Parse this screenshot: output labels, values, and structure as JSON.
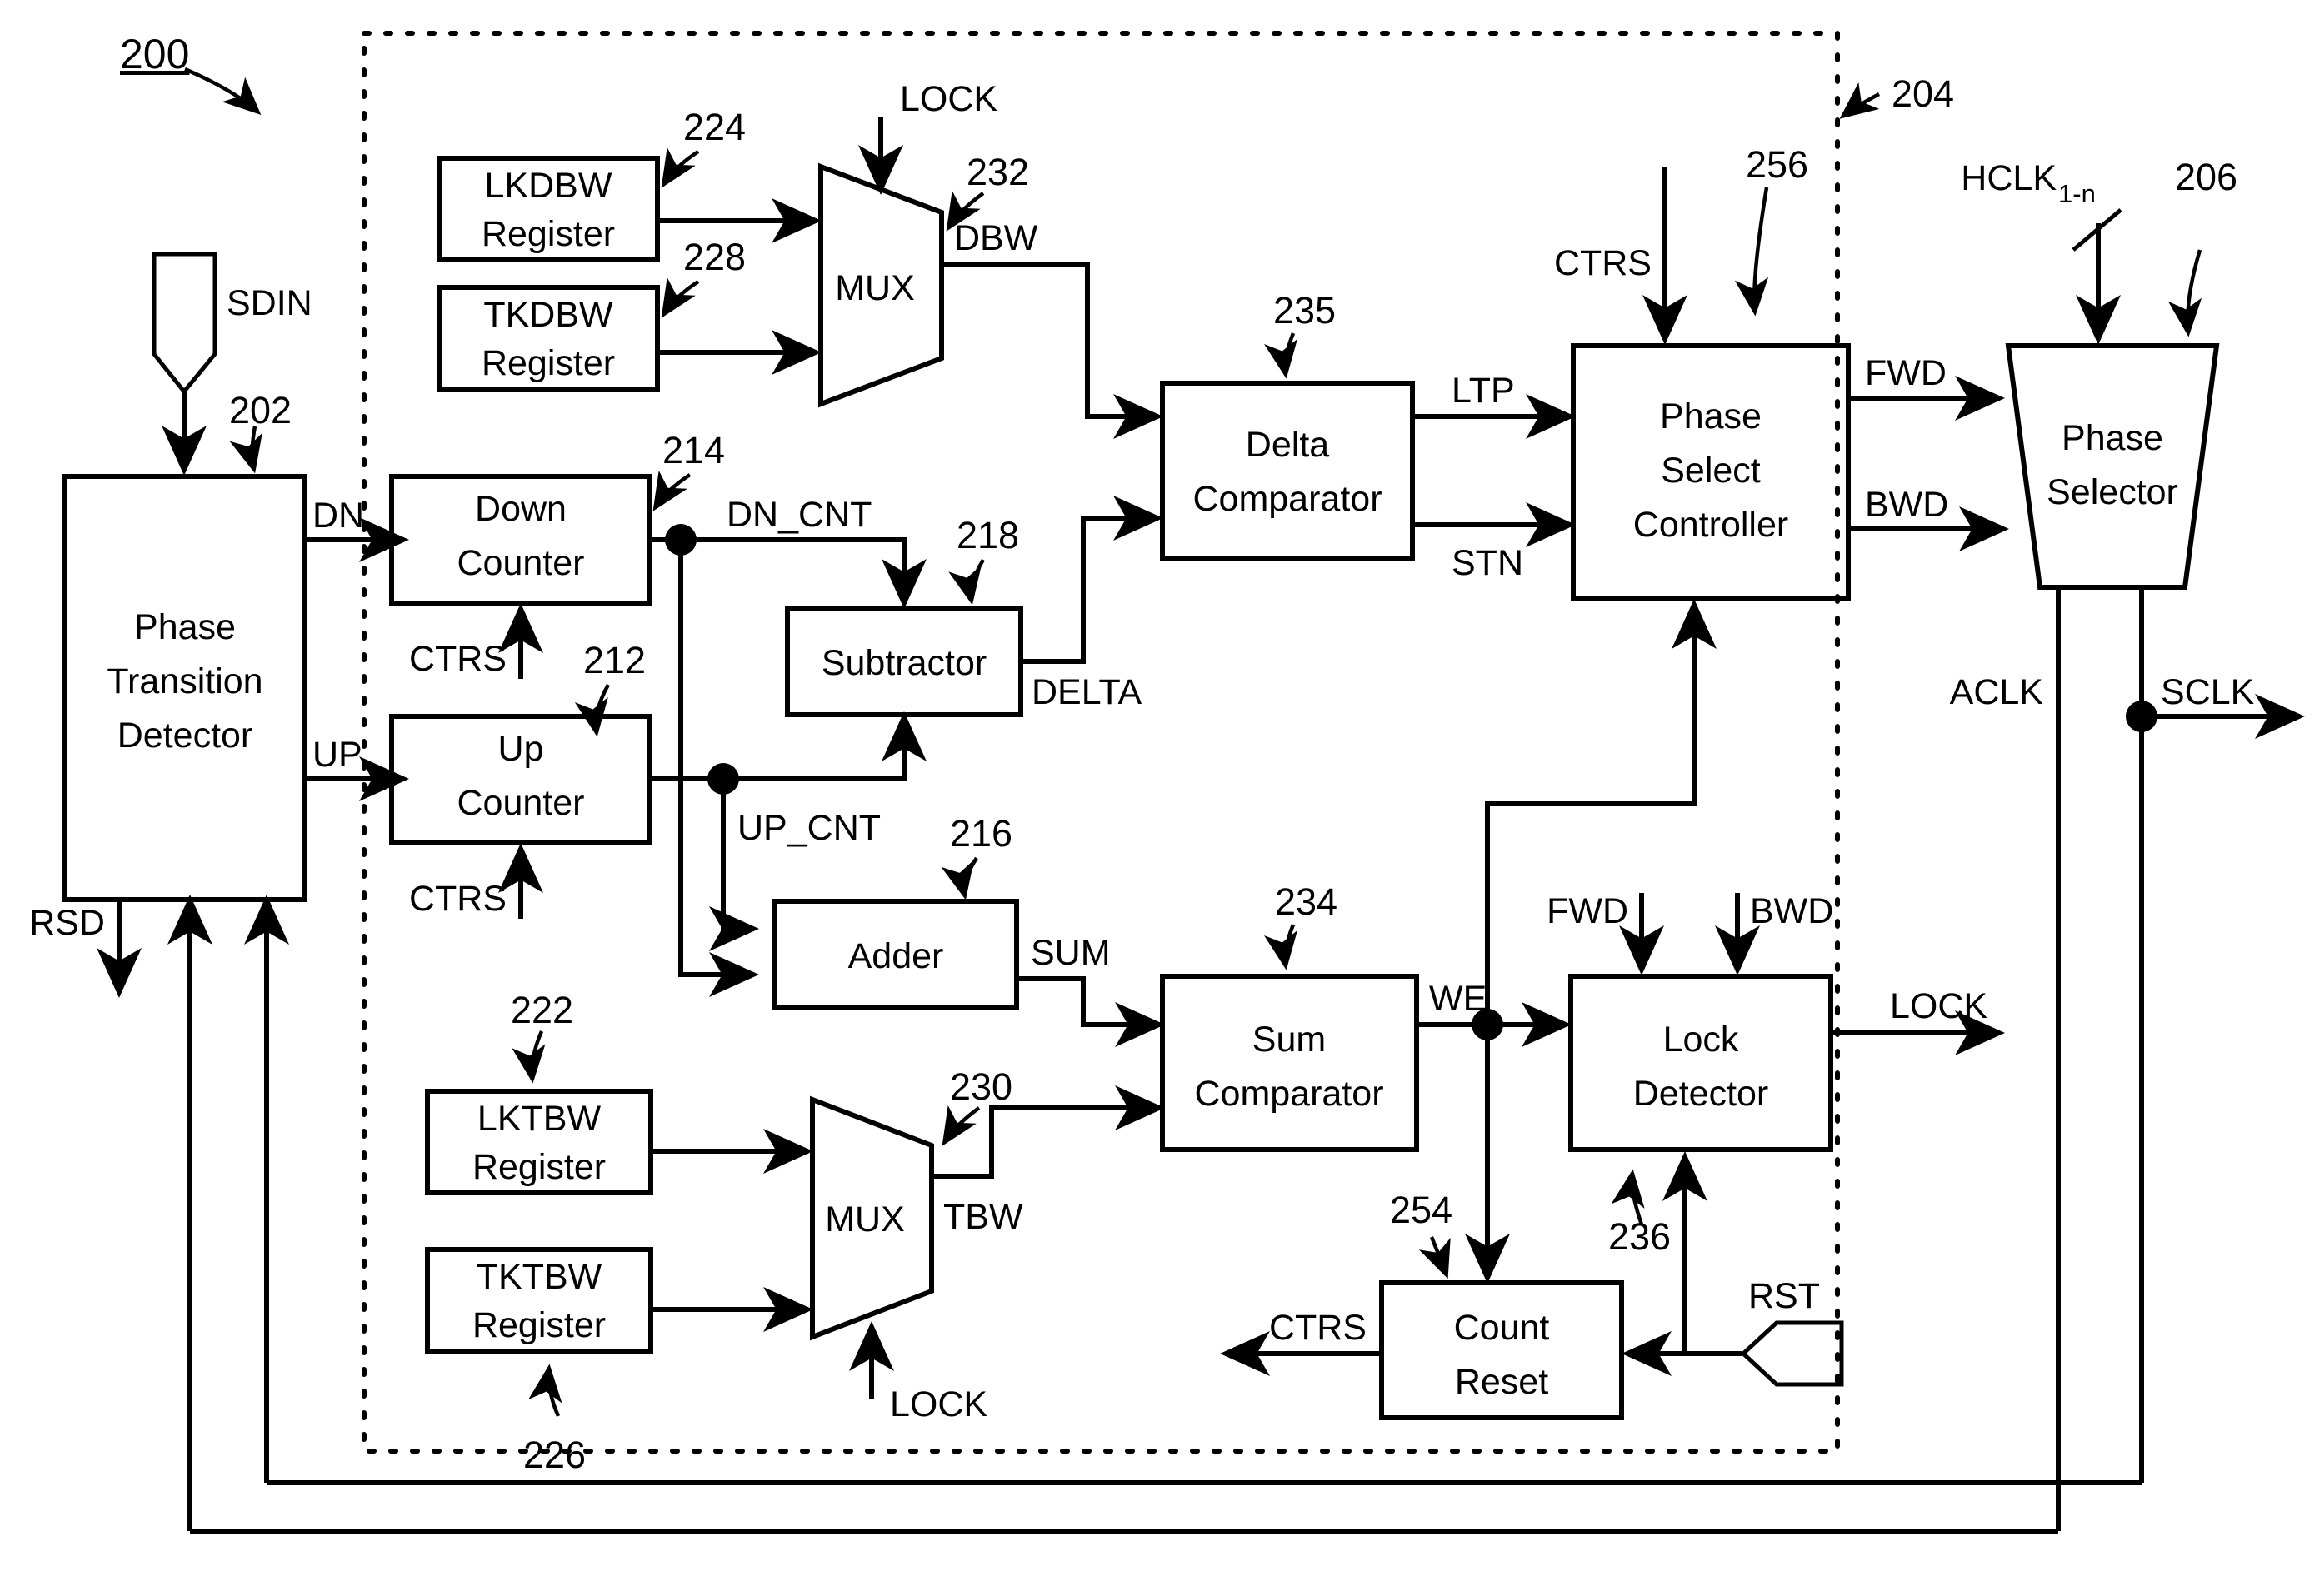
{
  "figure": {
    "number": "200",
    "inner_block_ref": "204"
  },
  "blocks": [
    {
      "id": "ptd",
      "lines": [
        "Phase",
        "Transition",
        "Detector"
      ],
      "ref": "202"
    },
    {
      "id": "lkdbw",
      "lines": [
        "LKDBW",
        "Register"
      ],
      "ref": "224"
    },
    {
      "id": "tkdbw",
      "lines": [
        "TKDBW",
        "Register"
      ],
      "ref": "228"
    },
    {
      "id": "mux_dbw",
      "lines": [
        "MUX"
      ],
      "ref": "232"
    },
    {
      "id": "down_counter",
      "lines": [
        "Down",
        "Counter"
      ],
      "ref": "214"
    },
    {
      "id": "up_counter",
      "lines": [
        "Up",
        "Counter"
      ],
      "ref": "212"
    },
    {
      "id": "subtractor",
      "lines": [
        "Subtractor"
      ],
      "ref": "218"
    },
    {
      "id": "adder",
      "lines": [
        "Adder"
      ],
      "ref": "216"
    },
    {
      "id": "delta_comparator",
      "lines": [
        "Delta",
        "Comparator"
      ],
      "ref": "235"
    },
    {
      "id": "phase_select_controller",
      "lines": [
        "Phase",
        "Select",
        "Controller"
      ],
      "ref": "256"
    },
    {
      "id": "phase_selector",
      "lines": [
        "Phase",
        "Selector"
      ],
      "ref": "206"
    },
    {
      "id": "lktbw",
      "lines": [
        "LKTBW",
        "Register"
      ],
      "ref": "222"
    },
    {
      "id": "tktbw",
      "lines": [
        "TKTBW",
        "Register"
      ],
      "ref": "226"
    },
    {
      "id": "mux_tbw",
      "lines": [
        "MUX"
      ],
      "ref": "230"
    },
    {
      "id": "sum_comparator",
      "lines": [
        "Sum",
        "Comparator"
      ],
      "ref": "234"
    },
    {
      "id": "lock_detector",
      "lines": [
        "Lock",
        "Detector"
      ],
      "ref": "236"
    },
    {
      "id": "count_reset",
      "lines": [
        "Count",
        "Reset"
      ],
      "ref": "254"
    }
  ],
  "labels": {
    "ptd_l1": "Phase",
    "ptd_l2": "Transition",
    "ptd_l3": "Detector",
    "lkdbw_l1": "LKDBW",
    "lkdbw_l2": "Register",
    "tkdbw_l1": "TKDBW",
    "tkdbw_l2": "Register",
    "mux_dbw": "MUX",
    "down_l1": "Down",
    "down_l2": "Counter",
    "up_l1": "Up",
    "up_l2": "Counter",
    "subtractor": "Subtractor",
    "adder": "Adder",
    "delta_l1": "Delta",
    "delta_l2": "Comparator",
    "psc_l1": "Phase",
    "psc_l2": "Select",
    "psc_l3": "Controller",
    "psel_l1": "Phase",
    "psel_l2": "Selector",
    "lktbw_l1": "LKTBW",
    "lktbw_l2": "Register",
    "tktbw_l1": "TKTBW",
    "tktbw_l2": "Register",
    "mux_tbw": "MUX",
    "sumcmp_l1": "Sum",
    "sumcmp_l2": "Comparator",
    "lockdet_l1": "Lock",
    "lockdet_l2": "Detector",
    "cntrst_l1": "Count",
    "cntrst_l2": "Reset"
  },
  "refs": {
    "fig": "200",
    "r202": "202",
    "r204": "204",
    "r206": "206",
    "r212": "212",
    "r214": "214",
    "r216": "216",
    "r218": "218",
    "r222": "222",
    "r224": "224",
    "r226": "226",
    "r228": "228",
    "r230": "230",
    "r232": "232",
    "r234": "234",
    "r235": "235",
    "r236": "236",
    "r254": "254",
    "r256": "256"
  },
  "signals": {
    "sdin": "SDIN",
    "rsd": "RSD",
    "dn": "DN",
    "up": "UP",
    "ctrs": "CTRS",
    "dn_cnt": "DN_CNT",
    "up_cnt": "UP_CNT",
    "delta": "DELTA",
    "sum": "SUM",
    "dbw": "DBW",
    "tbw": "TBW",
    "lock": "LOCK",
    "ltp": "LTP",
    "stn": "STN",
    "we": "WE",
    "fwd": "FWD",
    "bwd": "BWD",
    "aclk": "ACLK",
    "sclk": "SCLK",
    "rst": "RST",
    "hclk": "HCLK",
    "hclk_sub": "1-n"
  }
}
